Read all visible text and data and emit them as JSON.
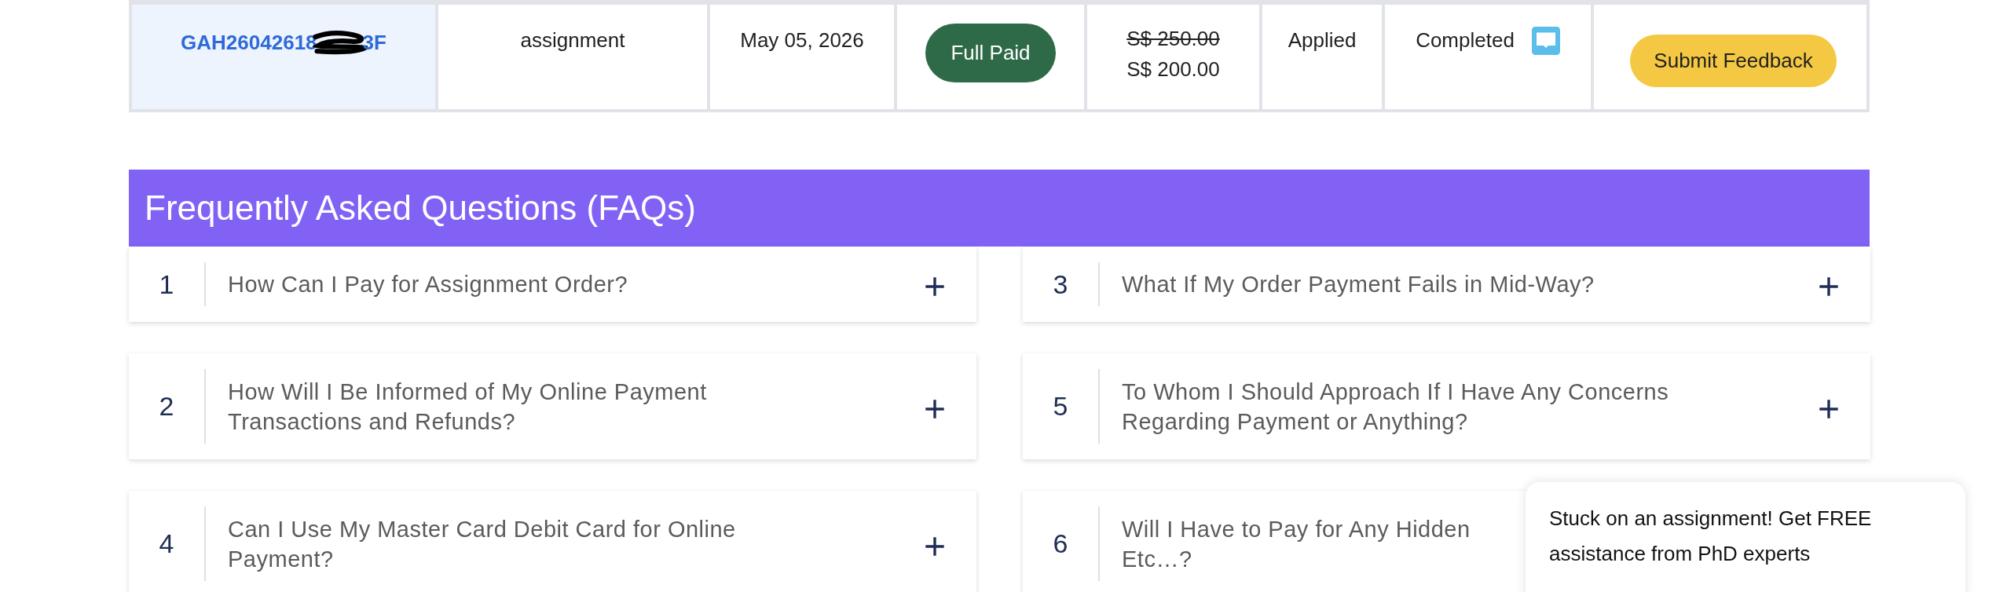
{
  "order_row": {
    "order_id": "GAH26042618",
    "order_id_end": "3F",
    "redacted": true,
    "service": "assignment",
    "date": "May 05, 2026",
    "payment_status": "Full Paid",
    "old_price": "S$ 250.00",
    "price": "S$ 200.00",
    "coupon": "Applied",
    "status": "Completed",
    "feedback_button": "Submit Feedback"
  },
  "faq": {
    "title": "Frequently Asked Questions (FAQs)",
    "items": [
      {
        "number": "1",
        "lines": [
          "How Can I Pay for Assignment Order?"
        ],
        "expand_icon_visible": true
      },
      {
        "number": "3",
        "lines": [
          "What If My Order Payment Fails in Mid-Way?"
        ],
        "expand_icon_visible": true
      },
      {
        "number": "2",
        "lines": [
          "How Will I Be Informed of My Online Payment",
          "Transactions and Refunds?"
        ],
        "expand_icon_visible": true
      },
      {
        "number": "5",
        "lines": [
          "To Whom I Should Approach If I Have Any Concerns",
          "Regarding Payment or Anything?"
        ],
        "expand_icon_visible": true
      },
      {
        "number": "4",
        "lines": [
          "Can I Use My Master Card Debit Card for Online",
          "Payment?"
        ],
        "expand_icon_visible": true
      },
      {
        "number": "6",
        "lines": [
          "Will I Have to Pay for Any Hidden",
          "Etc…?"
        ],
        "expand_icon_visible": false
      }
    ]
  },
  "chat_popup": {
    "text": "Stuck on an assignment! Get FREE assistance from PhD experts"
  }
}
